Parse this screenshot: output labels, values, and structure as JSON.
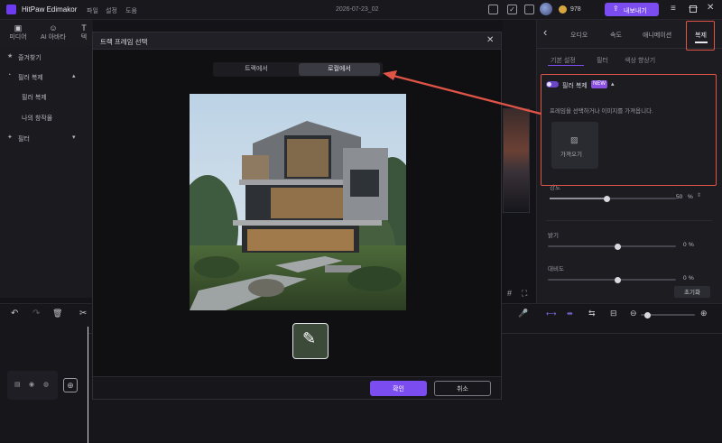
{
  "app": {
    "title": "HitPaw Edimakor",
    "menu": [
      "파일",
      "설정",
      "도움"
    ],
    "date": "2026-07-23_02",
    "credits": "978",
    "export_label": "내보내기"
  },
  "media_tabs": [
    {
      "icon": "media-icon",
      "label": "미디어"
    },
    {
      "icon": "ai-avatar-icon",
      "label": "AI 아바타"
    },
    {
      "icon": "text-icon",
      "label": "텍"
    }
  ],
  "left_panel": {
    "favorites": "즐겨찾기",
    "group": "필러 복제",
    "items": [
      "필러 복제",
      "나의 창작물"
    ],
    "filter": "필터"
  },
  "right_panel": {
    "tabs": [
      "오디오",
      "속도",
      "애니메이션",
      "복제"
    ],
    "subtabs": [
      "기본 설정",
      "필터",
      "색상 향상기"
    ],
    "clone_toggle_label": "필러 복제",
    "new_badge": "NEW",
    "hint": "프레임을 선택하거나 이미지를 가져옵니다.",
    "import_label": "가져오기",
    "strength_label": "강도",
    "strength_value": "50",
    "strength_unit": "%",
    "brightness_label": "밝기",
    "brightness_value": "0",
    "brightness_unit": "%",
    "contrast_label": "대비도",
    "contrast_value": "0",
    "contrast_unit": "%",
    "reset_label": "초기화"
  },
  "dialog": {
    "title": "트랙 프레임 선택",
    "seg_track": "트랙에서",
    "seg_local": "로컬에서",
    "confirm": "확인",
    "cancel": "취소"
  },
  "colors": {
    "accent": "#7b4cf0",
    "annotation": "#e05448"
  }
}
